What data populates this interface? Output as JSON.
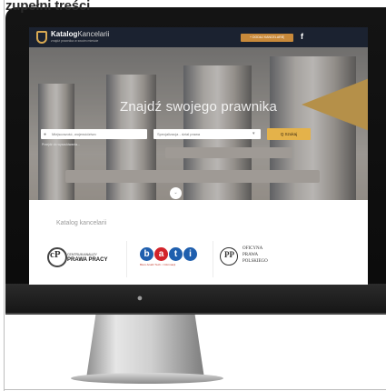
{
  "caption": {
    "text": "zupełni treści"
  },
  "site": {
    "logo_bold": "Katalog",
    "logo_light": "Kancelarii",
    "logo_sub": "znajdź prawnika w swoim mieście",
    "add_office_label": "+ DODAJ KANCELARIĘ",
    "facebook_glyph": "f"
  },
  "hero": {
    "title": "Znajdź swojego prawnika",
    "location_placeholder": "Miejscowość, województwo",
    "category_placeholder": "Specjalizacja - dział prawa",
    "search_label": "Q  Szukaj",
    "advanced_link": "Przejdź do wyszukiwania..."
  },
  "catalog": {
    "title": "Katalog kancelarii",
    "cap_letters": "cP",
    "cap_line1": "CENTRUM ANALIZY",
    "cap_line2": "PRAWA PRACY",
    "bati_letters": [
      "b",
      "a",
      "t",
      "i"
    ],
    "bati_sub": "Biuro Analiz Tech. i Informacji",
    "owpp_mark": "PP",
    "owpp_lines": [
      "OFICYNA",
      "PRAWA",
      "POLSKIEGO"
    ]
  },
  "colors": {
    "header_bg": "#1b2230",
    "accent_gold": "#d8a952",
    "search_button": "#e4b24a",
    "bati_blue": "#1f5fae",
    "bati_red": "#d2232a"
  }
}
